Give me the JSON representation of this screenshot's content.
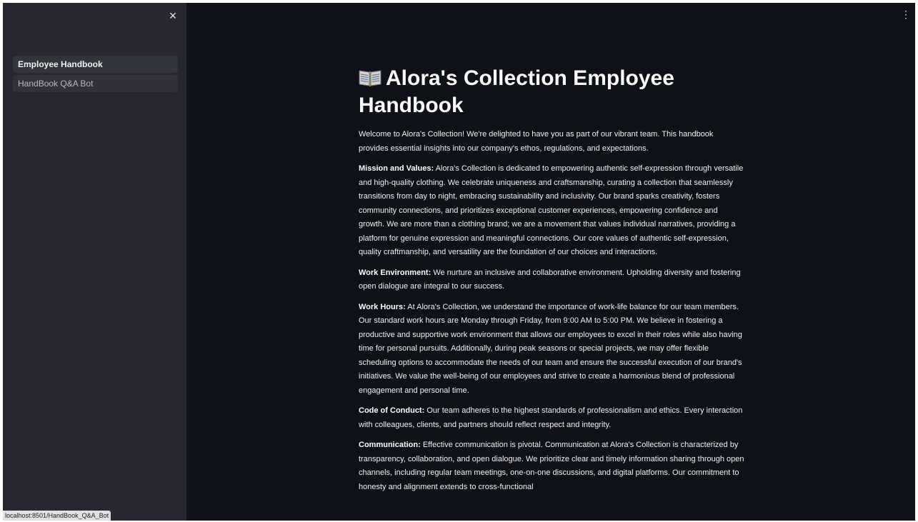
{
  "sidebar": {
    "close_icon": "×",
    "items": [
      {
        "label": "Employee Handbook",
        "active": true
      },
      {
        "label": "HandBook Q&A Bot",
        "active": false
      }
    ]
  },
  "status_bar": {
    "url": "localhost:8501/HandBook_Q&A_Bot"
  },
  "header": {
    "menu_icon": "⋮"
  },
  "main": {
    "title": "Alora's Collection Employee Handbook",
    "intro": "Welcome to Alora's Collection! We're delighted to have you as part of our vibrant team. This handbook provides essential insights into our company's ethos, regulations, and expectations.",
    "sections": [
      {
        "heading": "Mission and Values:",
        "body": "Alora's Collection is dedicated to empowering authentic self-expression through versatile and high-quality clothing. We celebrate uniqueness and craftsmanship, curating a collection that seamlessly transitions from day to night, embracing sustainability and inclusivity. Our brand sparks creativity, fosters community connections, and prioritizes exceptional customer experiences, empowering confidence and growth. We are more than a clothing brand; we are a movement that values individual narratives, providing a platform for genuine expression and meaningful connections. Our core values of authentic self-expression, quality craftmanship, and versatility are the foundation of our choices and interactions."
      },
      {
        "heading": "Work Environment:",
        "body": "We nurture an inclusive and collaborative environment. Upholding diversity and fostering open dialogue are integral to our success."
      },
      {
        "heading": "Work Hours:",
        "body": "At Alora's Collection, we understand the importance of work-life balance for our team members. Our standard work hours are Monday through Friday, from 9:00 AM to 5:00 PM. We believe in fostering a productive and supportive work environment that allows our employees to excel in their roles while also having time for personal pursuits. Additionally, during peak seasons or special projects, we may offer flexible scheduling options to accommodate the needs of our team and ensure the successful execution of our brand's initiatives. We value the well-being of our employees and strive to create a harmonious blend of professional engagement and personal time."
      },
      {
        "heading": "Code of Conduct:",
        "body": "Our team adheres to the highest standards of professionalism and ethics. Every interaction with colleagues, clients, and partners should reflect respect and integrity."
      },
      {
        "heading": "Communication:",
        "body": "Effective communication is pivotal. Communication at Alora's Collection is characterized by transparency, collaboration, and open dialogue. We prioritize clear and timely information sharing through open channels, including regular team meetings, one-on-one discussions, and digital platforms. Our commitment to honesty and alignment extends to cross-functional"
      }
    ]
  }
}
